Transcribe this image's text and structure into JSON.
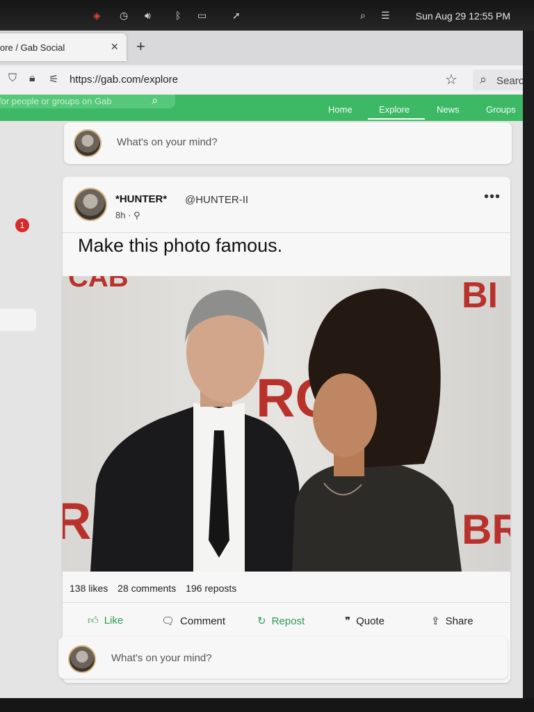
{
  "menubar": {
    "clock": "Sun Aug 29  12:55 PM"
  },
  "browser": {
    "tab_title": "ore / Gab Social",
    "tab_close": "×",
    "new_tab": "+",
    "url": "https://gab.com/explore",
    "search_placeholder": "Searc"
  },
  "gab": {
    "search_placeholder": "for people or groups on Gab",
    "nav": [
      "Home",
      "Explore",
      "News",
      "Groups"
    ],
    "active_nav": "Explore",
    "notification_count": "1",
    "composer_placeholder": "What's on your mind?"
  },
  "post": {
    "author_name": "*HUNTER*",
    "handle": "@HUNTER-II",
    "time": "8h",
    "text": "Make this photo famous.",
    "likes": "138 likes",
    "comments": "28 comments",
    "reposts": "196 reposts",
    "actions": {
      "like": "Like",
      "comment": "Comment",
      "repost": "Repost",
      "quote": "Quote",
      "share": "Share"
    }
  },
  "colors": {
    "gab_green": "#3db865",
    "action_green": "#2e9b52",
    "badge_red": "#d62b2b"
  }
}
